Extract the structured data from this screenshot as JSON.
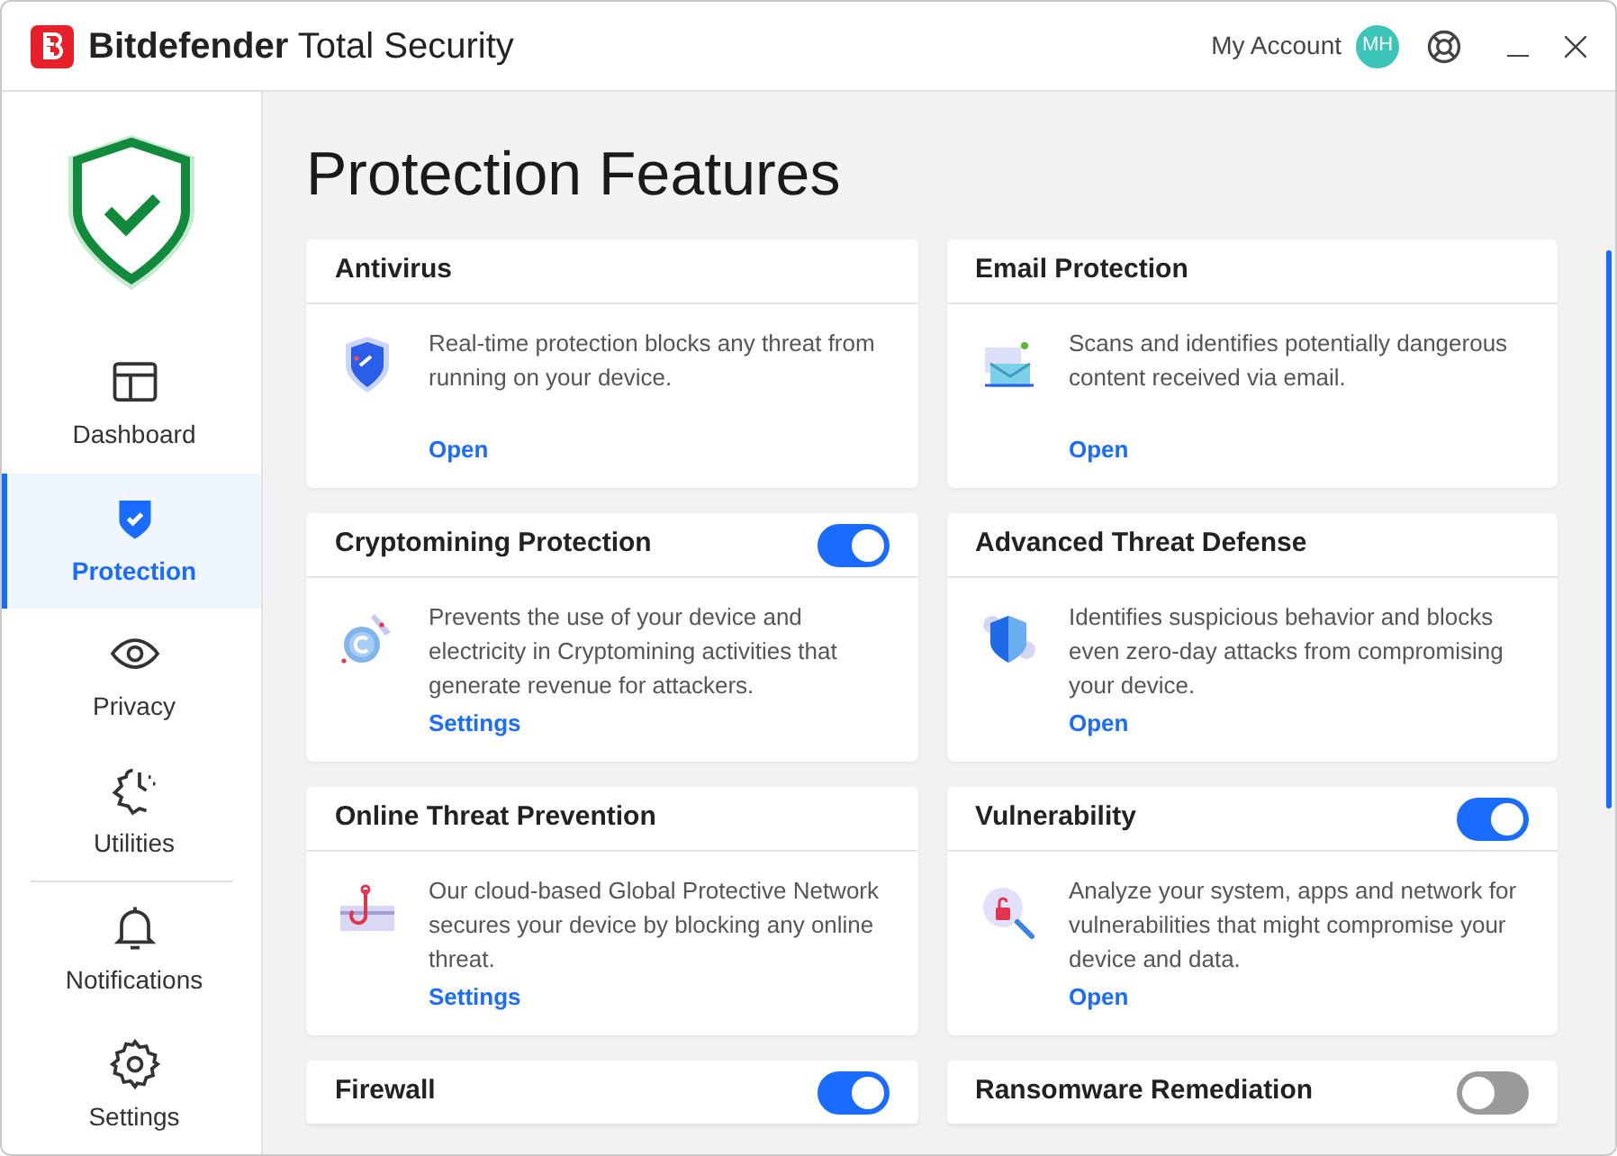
{
  "window": {
    "brand": "Bitdefender",
    "product": "Total Security",
    "account": "My Account",
    "avatar": "MH"
  },
  "sidebar": {
    "items": [
      {
        "label": "Dashboard",
        "selected": false
      },
      {
        "label": "Protection",
        "selected": true
      },
      {
        "label": "Privacy",
        "selected": false
      },
      {
        "label": "Utilities",
        "selected": false
      },
      {
        "label": "Notifications",
        "selected": false
      },
      {
        "label": "Settings",
        "selected": false
      }
    ]
  },
  "page_title": "Protection Features",
  "cards": [
    {
      "title": "Antivirus",
      "description": "Real-time protection blocks any threat from running on your device.",
      "link": "Open"
    },
    {
      "title": "Email Protection",
      "description": "Scans and identifies potentially dangerous content received via email.",
      "link": "Open"
    },
    {
      "title": "Cryptomining Protection",
      "on": true,
      "description": "Prevents the use of your device and electricity in Cryptomining activities that generate revenue for attackers.",
      "link": "Settings"
    },
    {
      "title": "Advanced Threat Defense",
      "description": "Identifies suspicious behavior and blocks even zero-day attacks from compromising your device.",
      "link": "Open"
    },
    {
      "title": "Online Threat Prevention",
      "description": "Our cloud-based Global Protective Network secures your device by blocking any online threat.",
      "link": "Settings"
    },
    {
      "title": "Vulnerability",
      "on": true,
      "description": "Analyze your system, apps and network for vulnerabilities that might compromise your device and data.",
      "link": "Open"
    },
    {
      "title": "Firewall",
      "on": true
    },
    {
      "title": "Ransomware Remediation",
      "on": false
    }
  ]
}
